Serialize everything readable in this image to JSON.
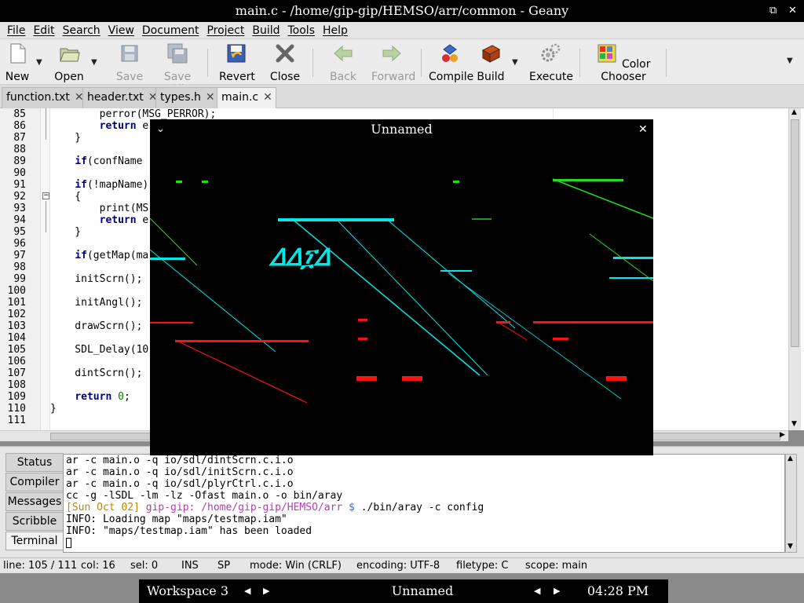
{
  "window_title": "main.c - /home/gip-gip/HEMSO/arr/common - Geany",
  "window_buttons": {
    "restore": "⧉",
    "close": "✕"
  },
  "menu": [
    "File",
    "Edit",
    "Search",
    "View",
    "Document",
    "Project",
    "Build",
    "Tools",
    "Help"
  ],
  "toolbar": {
    "new": "New",
    "open": "Open",
    "save": "Save",
    "save_all": "Save All",
    "revert": "Revert",
    "close": "Close",
    "back": "Back",
    "forward": "Forward",
    "compile": "Compile",
    "build": "Build",
    "execute": "Execute",
    "color_chooser": "Color Chooser"
  },
  "tabs": [
    {
      "label": "function.txt",
      "active": false
    },
    {
      "label": "header.txt",
      "active": false
    },
    {
      "label": "types.h",
      "active": false
    },
    {
      "label": "main.c",
      "active": true
    }
  ],
  "line_numbers": [
    "85",
    "86",
    "87",
    "88",
    "89",
    "90",
    "91",
    "92",
    "93",
    "94",
    "95",
    "96",
    "97",
    "98",
    "99",
    "100",
    "101",
    "102",
    "103",
    "104",
    "105",
    "106",
    "107",
    "108",
    "109",
    "110",
    "111"
  ],
  "code_lines": [
    "        perror(MSG_PERROR);",
    "        return e",
    "    }",
    "",
    "    if(confName",
    "",
    "    if(!mapName)",
    "    {",
    "        print(MS",
    "        return e",
    "    }",
    "",
    "    if(getMap(ma",
    "",
    "    initScrn();",
    "",
    "    initAngl();",
    "",
    "    drawScrn();",
    "",
    "    SDL_Delay(10",
    "",
    "    dintScrn();",
    "",
    "    return 0;",
    "}",
    ""
  ],
  "panel_tabs": [
    "Status",
    "Compiler",
    "Messages",
    "Scribble",
    "Terminal"
  ],
  "terminal": {
    "lines": [
      "ar -c main.o -q io/sdl/dintScrn.c.i.o",
      "ar -c main.o -q io/sdl/initScrn.c.i.o",
      "ar -c main.o -q io/sdl/plyrCtrl.c.i.o",
      "cc -g -lSDL -lm -lz -Ofast main.o -o bin/aray"
    ],
    "prompt_date": "[Sun Oct 02]",
    "prompt_user": "gip-gip:",
    "prompt_path": "/home/gip-gip/HEMSO/arr",
    "prompt_symbol": "$",
    "prompt_cmd": "./bin/aray -c config",
    "info_lines": [
      "INFO: Loading map \"maps/testmap.iam\"",
      "INFO: \"maps/testmap.iam\" has been loaded"
    ]
  },
  "status": {
    "line": "line: 105 / 111",
    "col": "col: 16",
    "sel": "sel: 0",
    "ins": "INS",
    "sp": "SP",
    "mode": "mode: Win (CRLF)",
    "encoding": "encoding: UTF-8",
    "filetype": "filetype: C",
    "scope": "scope: main"
  },
  "taskbar": {
    "workspace": "Workspace 3",
    "window": "Unnamed",
    "time": "04:28 PM"
  },
  "sdl_window": {
    "title": "Unnamed",
    "close": "✕",
    "menu": "⌄"
  },
  "colors": {
    "cyan": "#00e8e8",
    "green": "#22dd22",
    "red": "#ff1111",
    "prompt_yellow": "#b58900",
    "prompt_magenta": "#b03fb0",
    "keyword": "#00007f"
  }
}
